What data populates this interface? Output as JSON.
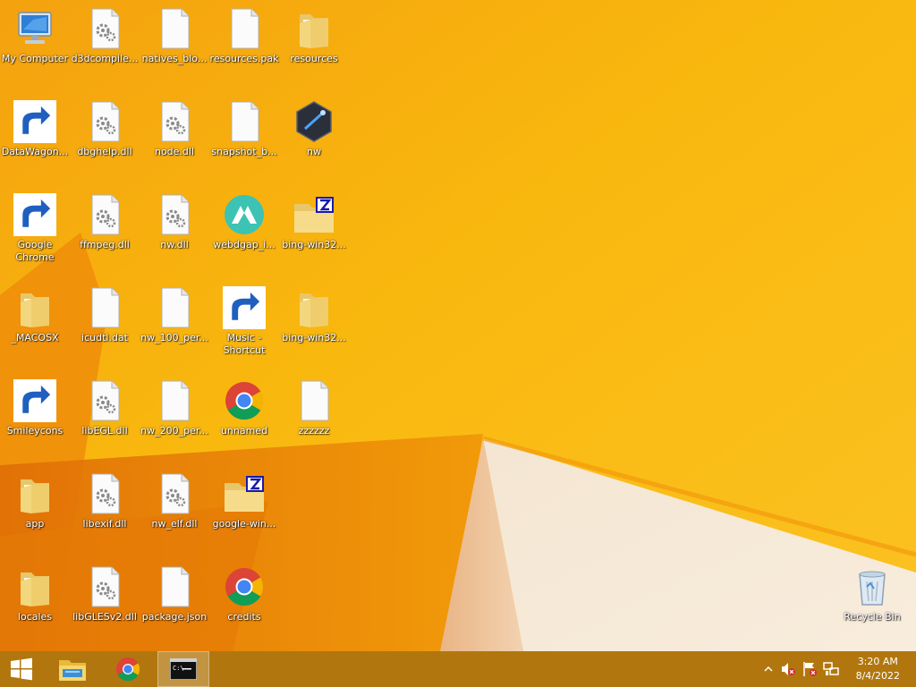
{
  "desktop": {
    "icons": [
      {
        "label": "My Computer"
      },
      {
        "label": "d3dcompile..."
      },
      {
        "label": "natives_blo..."
      },
      {
        "label": "resources.pak"
      },
      {
        "label": "resources"
      },
      {
        "label": "DataWagon..."
      },
      {
        "label": "dbghelp.dll"
      },
      {
        "label": "node.dll"
      },
      {
        "label": "snapshot_b..."
      },
      {
        "label": "nw"
      },
      {
        "label": "Google Chrome"
      },
      {
        "label": "ffmpeg.dll"
      },
      {
        "label": "nw.dll"
      },
      {
        "label": "webdgap_i..."
      },
      {
        "label": "bing-win32..."
      },
      {
        "label": "_MACOSX"
      },
      {
        "label": "icudtl.dat"
      },
      {
        "label": "nw_100_per..."
      },
      {
        "label": "Music - Shortcut"
      },
      {
        "label": "bing-win32..."
      },
      {
        "label": "Smileycons"
      },
      {
        "label": "libEGL.dll"
      },
      {
        "label": "nw_200_per..."
      },
      {
        "label": "unnamed"
      },
      {
        "label": "zzzzzz"
      },
      {
        "label": "app"
      },
      {
        "label": "libexif.dll"
      },
      {
        "label": "nw_elf.dll"
      },
      {
        "label": "google-win..."
      },
      {
        "label": "locales"
      },
      {
        "label": "libGLESv2.dll"
      },
      {
        "label": "package.json"
      },
      {
        "label": "credits"
      },
      {
        "label": "Recycle Bin"
      }
    ]
  },
  "taskbar": {
    "buttons": [
      {
        "icon": "windows-start-icon"
      },
      {
        "icon": "file-explorer-icon"
      },
      {
        "icon": "chrome-icon"
      },
      {
        "icon": "command-prompt-icon"
      }
    ],
    "tray": {
      "icons": [
        "show-hidden-icons-chevron-icon",
        "volume-muted-icon",
        "action-center-flag-icon",
        "network-icon"
      ],
      "time": "3:20 AM",
      "date": "8/4/2022"
    }
  },
  "colors": {
    "wallpaper": "#f7b40c",
    "wallpaper_dark": "#ea7c08",
    "wallpaper_light": "#f6e3cc",
    "taskbar": "#9a5f10"
  }
}
